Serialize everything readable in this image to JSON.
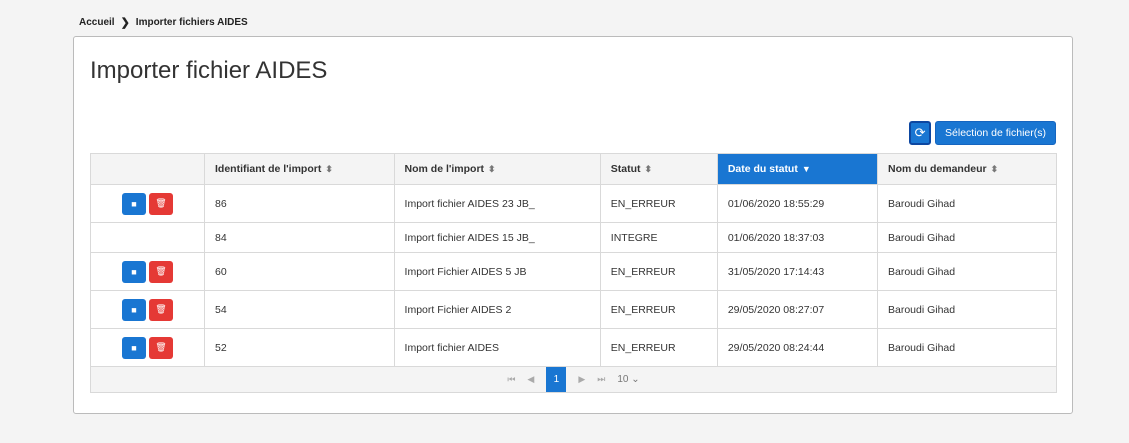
{
  "breadcrumb": {
    "home": "Accueil",
    "separator": "❯",
    "current": "Importer fichiers AIDES"
  },
  "page": {
    "title": "Importer fichier AIDES"
  },
  "toolbar": {
    "refresh_icon": "⟳",
    "select_label": "Sélection de fichier(s)"
  },
  "table": {
    "columns": [
      "Identifiant de l'import",
      "Nom de l'import",
      "Statut",
      "Date du statut",
      "Nom du demandeur"
    ],
    "sort_icon": "⬍",
    "sort_desc_icon": "▼",
    "rows": [
      {
        "id": "86",
        "name": "Import fichier AIDES 23 JB_",
        "status": "EN_ERREUR",
        "date": "01/06/2020 18:55:29",
        "requester": "Baroudi Gihad"
      },
      {
        "id": "84",
        "name": "Import fichier AIDES 15 JB_",
        "status": "INTEGRE",
        "date": "01/06/2020 18:37:03",
        "requester": "Baroudi Gihad"
      },
      {
        "id": "60",
        "name": "Import Fichier AIDES 5 JB",
        "status": "EN_ERREUR",
        "date": "31/05/2020 17:14:43",
        "requester": "Baroudi Gihad"
      },
      {
        "id": "54",
        "name": "Import Fichier AIDES 2",
        "status": "EN_ERREUR",
        "date": "29/05/2020 08:27:07",
        "requester": "Baroudi Gihad"
      },
      {
        "id": "52",
        "name": "Import fichier AIDES",
        "status": "EN_ERREUR",
        "date": "29/05/2020 08:24:44",
        "requester": "Baroudi Gihad"
      }
    ],
    "actions": {
      "view_icon": "■",
      "delete_icon": "🗑"
    }
  },
  "pager": {
    "first": "⏮",
    "prev": "◀",
    "page": "1",
    "next": "▶",
    "last": "⏭",
    "rows_per_page": "10",
    "dropdown_icon": "⌄"
  },
  "colors": {
    "accent": "#1976d2",
    "danger": "#e53935"
  }
}
